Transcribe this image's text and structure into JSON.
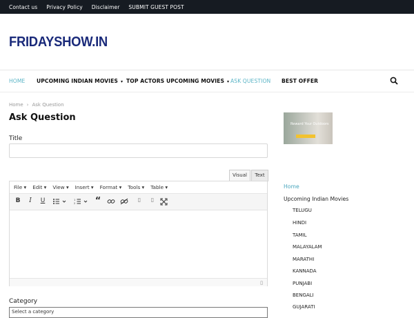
{
  "topbar": {
    "links": [
      "Contact us",
      "Privacy Policy",
      "Disclaimer",
      "SUBMIT GUEST POST"
    ]
  },
  "logo": {
    "text": "FRIDAYSHOW.IN"
  },
  "nav": {
    "items": [
      "HOME",
      "UPCOMING INDIAN MOVIES",
      "TOP ACTORS UPCOMING MOVIES",
      "ASK QUESTION",
      "BEST OFFER"
    ],
    "search_icon": "search-icon"
  },
  "breadcrumb": {
    "home": "Home",
    "separator": "›",
    "current": "Ask Question"
  },
  "page": {
    "title": "Ask Question",
    "title_label": "Title",
    "category_label": "Category",
    "category_value": "Select a category"
  },
  "editor": {
    "tab_visual": "Visual",
    "tab_text": "Text",
    "menu": [
      "File ▾",
      "Edit ▾",
      "View ▾",
      "Insert ▾",
      "Format ▾",
      "Tools ▾",
      "Table ▾"
    ],
    "buttons": [
      "B",
      "I",
      "U"
    ],
    "resize_icon": "resize-handle-icon"
  },
  "sidebar": {
    "ad_heading": "Reward Your Outdoors",
    "home": "Home",
    "upcoming": "Upcoming Indian Movies",
    "languages": [
      "TELUGU",
      "HINDI",
      "TAMIL",
      "MALAYALAM",
      "MARATHI",
      "KANNADA",
      "PUNJABI",
      "BENGALI",
      "GUJARATI"
    ]
  },
  "colors": {
    "topbar_bg": "#161b22",
    "logo": "#1a2a7a",
    "accent": "#5ab4c6"
  }
}
